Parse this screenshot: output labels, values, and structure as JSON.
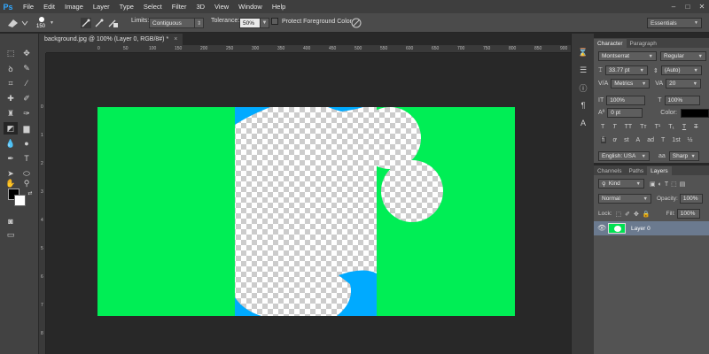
{
  "app": {
    "logo": "Ps"
  },
  "menu": [
    "File",
    "Edit",
    "Image",
    "Layer",
    "Type",
    "Select",
    "Filter",
    "3D",
    "View",
    "Window",
    "Help"
  ],
  "window_controls": [
    "–",
    "□",
    "✕"
  ],
  "options": {
    "brush_size": "150",
    "limits_label": "Limits:",
    "limits_value": "Contiguous",
    "tolerance_label": "Tolerance:",
    "tolerance_value": "50%",
    "protect_label": "Protect Foreground Color",
    "workspace": "Essentials"
  },
  "document": {
    "tab_title": "background.jpg @ 100% (Layer 0, RGB/8#) *",
    "close_glyph": "×",
    "ruler_h": [
      "0",
      "50",
      "100",
      "150",
      "200",
      "250",
      "300",
      "350",
      "400",
      "450",
      "500",
      "550",
      "600",
      "650",
      "700",
      "750",
      "800",
      "850",
      "900",
      "950"
    ],
    "ruler_v": [
      "0",
      "1",
      "2",
      "3",
      "4",
      "5",
      "6",
      "7",
      "8"
    ],
    "colors": {
      "green": "#00EE55",
      "blue": "#00AAFF"
    }
  },
  "character_panel": {
    "tabs": [
      "Character",
      "Paragraph"
    ],
    "font_family": "Montserrat",
    "font_style": "Regular",
    "font_size": "33.77 pt",
    "leading": "(Auto)",
    "kerning": "Metrics",
    "tracking": "20",
    "vscale": "100%",
    "hscale": "100%",
    "baseline": "0 pt",
    "color_label": "Color:",
    "language": "English: USA",
    "antialias": "Sharp",
    "style_glyphs": [
      "T",
      "T",
      "TT",
      "Tт",
      "T¹",
      "T₁",
      "T",
      "T"
    ],
    "opentype_glyphs": [
      "fi",
      "ơ",
      "st",
      "A",
      "ad",
      "T",
      "1st",
      "½"
    ]
  },
  "layers_panel": {
    "tabs": [
      "Channels",
      "Paths",
      "Layers"
    ],
    "kind_label": "Kind",
    "blend_mode": "Normal",
    "opacity_label": "Opacity:",
    "opacity_value": "100%",
    "lock_label": "Lock:",
    "fill_label": "Fill:",
    "fill_value": "100%",
    "layer_name": "Layer 0"
  }
}
